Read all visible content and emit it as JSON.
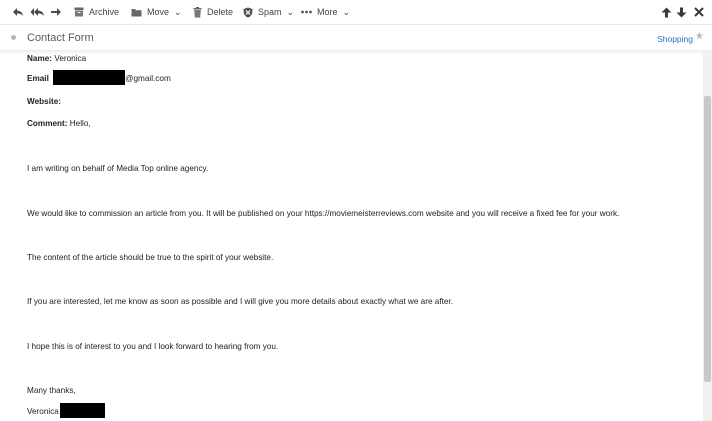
{
  "toolbar": {
    "archive_label": "Archive",
    "move_label": "Move",
    "delete_label": "Delete",
    "spam_label": "Spam",
    "more_label": "More",
    "caret": "⌄"
  },
  "message": {
    "subject": "Contact Form",
    "category": "Shopping",
    "star": "★"
  },
  "form": {
    "name_label": "Name:",
    "name_value": "Veronica",
    "email_label": "Email",
    "email_domain": "@gmail.com",
    "website_label": "Website:",
    "comment_label": "Comment:",
    "comment_greeting": "Hello,"
  },
  "paragraphs": [
    "I am writing on behalf of Media Top online agency.",
    "We would like to commission an article from you. It will be published on your https://moviemeisterreviews.com website and you will receive a fixed fee for your work.",
    "The content of the article should be true to the spirit of your website.",
    "If you are interested, let me know as soon as possible and I will give you more details about exactly what we are after.",
    "I hope this is of interest to you and I look forward to hearing from you."
  ],
  "signoff": "Many thanks,",
  "signature_name": "Veronica",
  "colors": {
    "link": "#2b72c8",
    "redaction": "#000000"
  }
}
